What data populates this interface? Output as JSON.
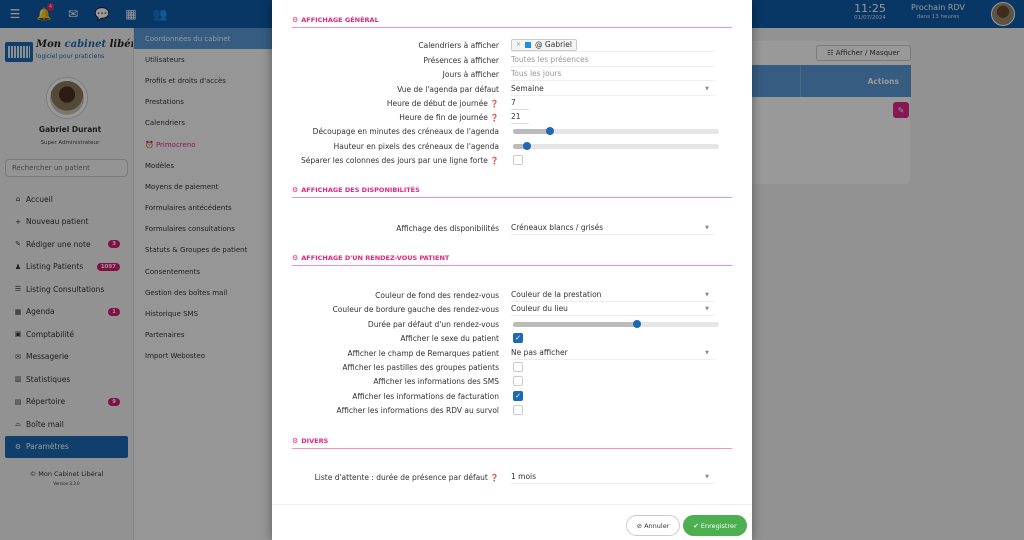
{
  "topbar": {
    "icons": [
      {
        "name": "menu-icon",
        "glyph": "☰"
      },
      {
        "name": "bell-icon",
        "glyph": "🔔",
        "badge": "4"
      },
      {
        "name": "mail-icon",
        "glyph": "✉"
      },
      {
        "name": "chat-icon",
        "glyph": "💬"
      },
      {
        "name": "calendar-icon",
        "glyph": "📅"
      },
      {
        "name": "users-icon",
        "glyph": "👥"
      }
    ],
    "time": "11:25",
    "date": "01/07/2024",
    "next_rdv_label": "Prochain RDV",
    "next_rdv_value": "dans 13 heures"
  },
  "sidebar": {
    "logo_name_1": "Mon ",
    "logo_name_2": "cabinet",
    "logo_name_3": " libéral",
    "logo_sub": "logiciel pour praticiens",
    "user_name": "Gabriel Durant",
    "user_role": "Super Administrateur",
    "search_placeholder": "Rechercher un patient",
    "items": [
      {
        "label": "Accueil",
        "icon": "⌂",
        "name": "home-icon"
      },
      {
        "label": "Nouveau patient",
        "icon": "+",
        "name": "plus-icon"
      },
      {
        "label": "Rédiger une note",
        "icon": "✎",
        "name": "pencil-icon",
        "badge": "3"
      },
      {
        "label": "Listing Patients",
        "icon": "♟",
        "name": "user-icon",
        "badge": "1097"
      },
      {
        "label": "Listing Consultations",
        "icon": "☰",
        "name": "list-icon"
      },
      {
        "label": "Agenda",
        "icon": "▦",
        "name": "calendar-icon",
        "badge": "1"
      },
      {
        "label": "Comptabilité",
        "icon": "▣",
        "name": "calculator-icon"
      },
      {
        "label": "Messagerie",
        "icon": "✉",
        "name": "messages-icon"
      },
      {
        "label": "Statistiques",
        "icon": "▥",
        "name": "chart-icon"
      },
      {
        "label": "Répertoire",
        "icon": "▤",
        "name": "addressbook-icon",
        "badge": "9"
      },
      {
        "label": "Boîte mail",
        "icon": "⌓",
        "name": "inbox-icon"
      },
      {
        "label": "Paramètres",
        "icon": "⚙",
        "name": "gear-icon",
        "active": true
      }
    ],
    "copyright": "© Mon Cabinet Libéral",
    "version": "Version 3.3.0"
  },
  "submenu": {
    "items": [
      {
        "label": "Coordonnées du cabinet",
        "active": true
      },
      {
        "label": "Utilisateurs"
      },
      {
        "label": "Profils et droits d'accès"
      },
      {
        "label": "Prestations"
      },
      {
        "label": "Calendriers"
      },
      {
        "label": "⏰ Primocreno",
        "pink": true
      },
      {
        "label": "Modèles"
      },
      {
        "label": "Moyens de paiement"
      },
      {
        "label": "Formulaires antécédents"
      },
      {
        "label": "Formulaires consultations"
      },
      {
        "label": "Statuts & Groupes de patient"
      },
      {
        "label": "Consentements"
      },
      {
        "label": "Gestion des boîtes mail"
      },
      {
        "label": "Historique SMS"
      },
      {
        "label": "Partenaires"
      },
      {
        "label": "Import Webosteo"
      }
    ]
  },
  "background": {
    "show_hide_label": "☷ Afficher / Masquer",
    "actions_header": "Actions"
  },
  "modal": {
    "sections": {
      "general": "AFFICHAGE GÉNÉRAL",
      "dispo": "AFFICHAGE DES DISPONIBILITÉS",
      "rdv": "AFFICHAGE D'UN RENDEZ-VOUS PATIENT",
      "divers": "DIVERS"
    },
    "general": {
      "calendars_label": "Calendriers à afficher",
      "calendars_tag": "@ Gabriel",
      "calendars_tag_color": "#1e8fe6",
      "presences_label": "Présences à afficher",
      "presences_placeholder": "Toutes les présences",
      "days_label": "Jours à afficher",
      "days_placeholder": "Tous les jours",
      "view_label": "Vue de l'agenda par défaut",
      "view_value": "Semaine",
      "start_label": "Heure de début de journée",
      "start_value": "7",
      "end_label": "Heure de fin de journée",
      "end_value": "21",
      "slot_minutes_label": "Découpage en minutes des créneaux de l'agenda",
      "slot_minutes_fraction": 0.18,
      "slot_height_label": "Hauteur en pixels des créneaux de l'agenda",
      "slot_height_fraction": 0.07,
      "separate_label": "Séparer les colonnes des jours par une ligne forte",
      "separate_checked": false
    },
    "dispo": {
      "label": "Affichage des disponibilités",
      "value": "Créneaux blancs / grisés"
    },
    "rdv": {
      "bg_label": "Couleur de fond des rendez-vous",
      "bg_value": "Couleur de la prestation",
      "border_label": "Couleur de bordure gauche des rendez-vous",
      "border_value": "Couleur du lieu",
      "duration_label": "Durée par défaut d'un rendez-vous",
      "duration_fraction": 0.6,
      "sex_label": "Afficher le sexe du patient",
      "sex_checked": true,
      "remarks_label": "Afficher le champ de Remarques patient",
      "remarks_value": "Ne pas afficher",
      "groups_label": "Afficher les pastilles des groupes patients",
      "groups_checked": false,
      "sms_label": "Afficher les informations des SMS",
      "sms_checked": false,
      "billing_label": "Afficher les informations de facturation",
      "billing_checked": true,
      "hover_label": "Afficher les informations des RDV au survol",
      "hover_checked": false
    },
    "divers": {
      "waitlist_label": "Liste d'attente : durée de présence par défaut",
      "waitlist_value": "1 mois"
    },
    "cancel_label": "⊘ Annuler",
    "save_label": "✔ Enregistrer"
  }
}
